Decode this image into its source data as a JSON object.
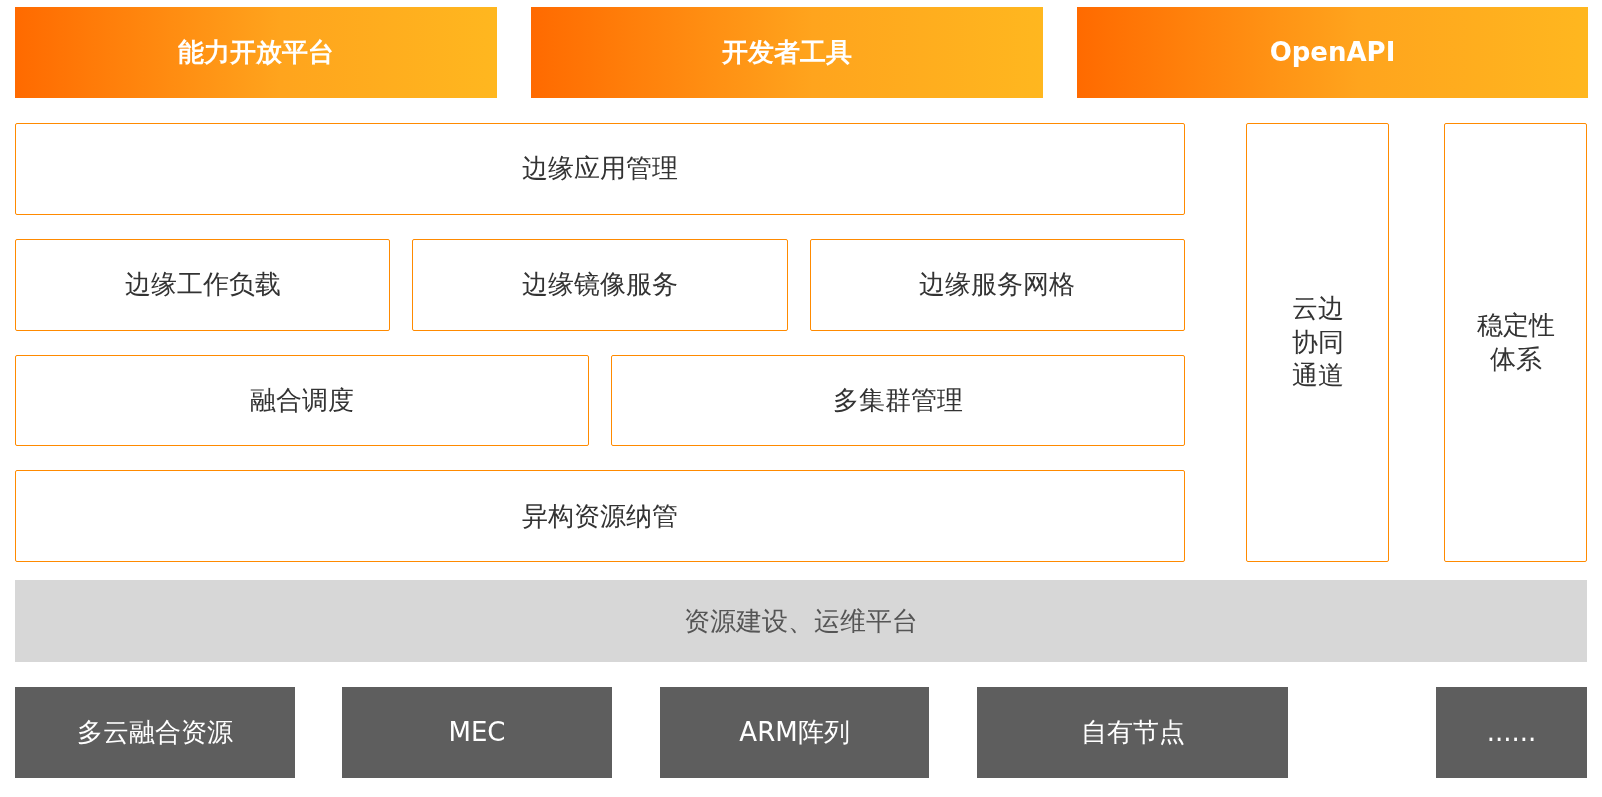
{
  "top_bars": [
    {
      "label": "能力开放平台"
    },
    {
      "label": "开发者工具"
    },
    {
      "label": "OpenAPI"
    }
  ],
  "module_rows": [
    [
      "边缘应用管理"
    ],
    [
      "边缘工作负载",
      "边缘镜像服务",
      "边缘服务网格"
    ],
    [
      "融合调度",
      "多集群管理"
    ],
    [
      "异构资源纳管"
    ]
  ],
  "side_columns": [
    {
      "label": "云边协同通道"
    },
    {
      "label": "稳定性体系"
    }
  ],
  "base_platform": {
    "label": "资源建设、运维平台"
  },
  "resources": [
    {
      "label": "多云融合资源"
    },
    {
      "label": "MEC"
    },
    {
      "label": "ARM阵列"
    },
    {
      "label": "自有节点"
    },
    {
      "label": "......"
    }
  ]
}
